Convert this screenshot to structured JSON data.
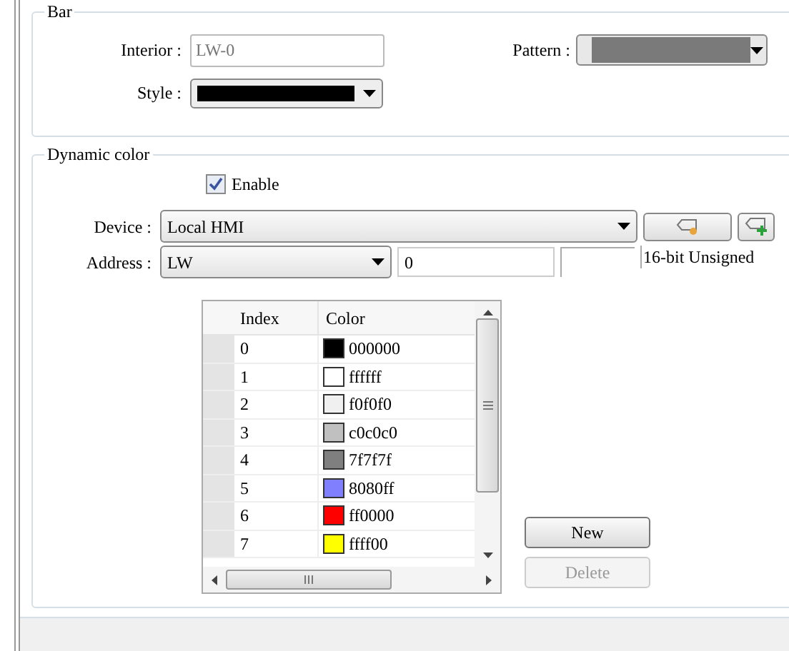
{
  "bar": {
    "legend": "Bar",
    "interior": {
      "label": "Interior :",
      "value": "LW-0"
    },
    "pattern": {
      "label": "Pattern :"
    },
    "style": {
      "label": "Style :"
    }
  },
  "dynamic_color": {
    "legend": "Dynamic color",
    "enable": {
      "label": "Enable",
      "checked": true
    },
    "device": {
      "label": "Device :",
      "value": "Local HMI"
    },
    "address": {
      "label": "Address :",
      "type": "LW",
      "value": "0",
      "format": "16-bit Unsigned"
    },
    "table": {
      "columns": [
        "Index",
        "Color"
      ],
      "rows": [
        {
          "index": "0",
          "value": "000000",
          "color": "#000000"
        },
        {
          "index": "1",
          "value": "ffffff",
          "color": "#ffffff"
        },
        {
          "index": "2",
          "value": "f0f0f0",
          "color": "#f0f0f0"
        },
        {
          "index": "3",
          "value": "c0c0c0",
          "color": "#c0c0c0"
        },
        {
          "index": "4",
          "value": "7f7f7f",
          "color": "#7f7f7f"
        },
        {
          "index": "5",
          "value": "8080ff",
          "color": "#8080ff"
        },
        {
          "index": "6",
          "value": "ff0000",
          "color": "#ff0000"
        },
        {
          "index": "7",
          "value": "ffff00",
          "color": "#ffff00"
        }
      ]
    },
    "buttons": [
      {
        "label": "New",
        "disabled": false
      },
      {
        "label": "Delete",
        "disabled": true
      }
    ]
  }
}
